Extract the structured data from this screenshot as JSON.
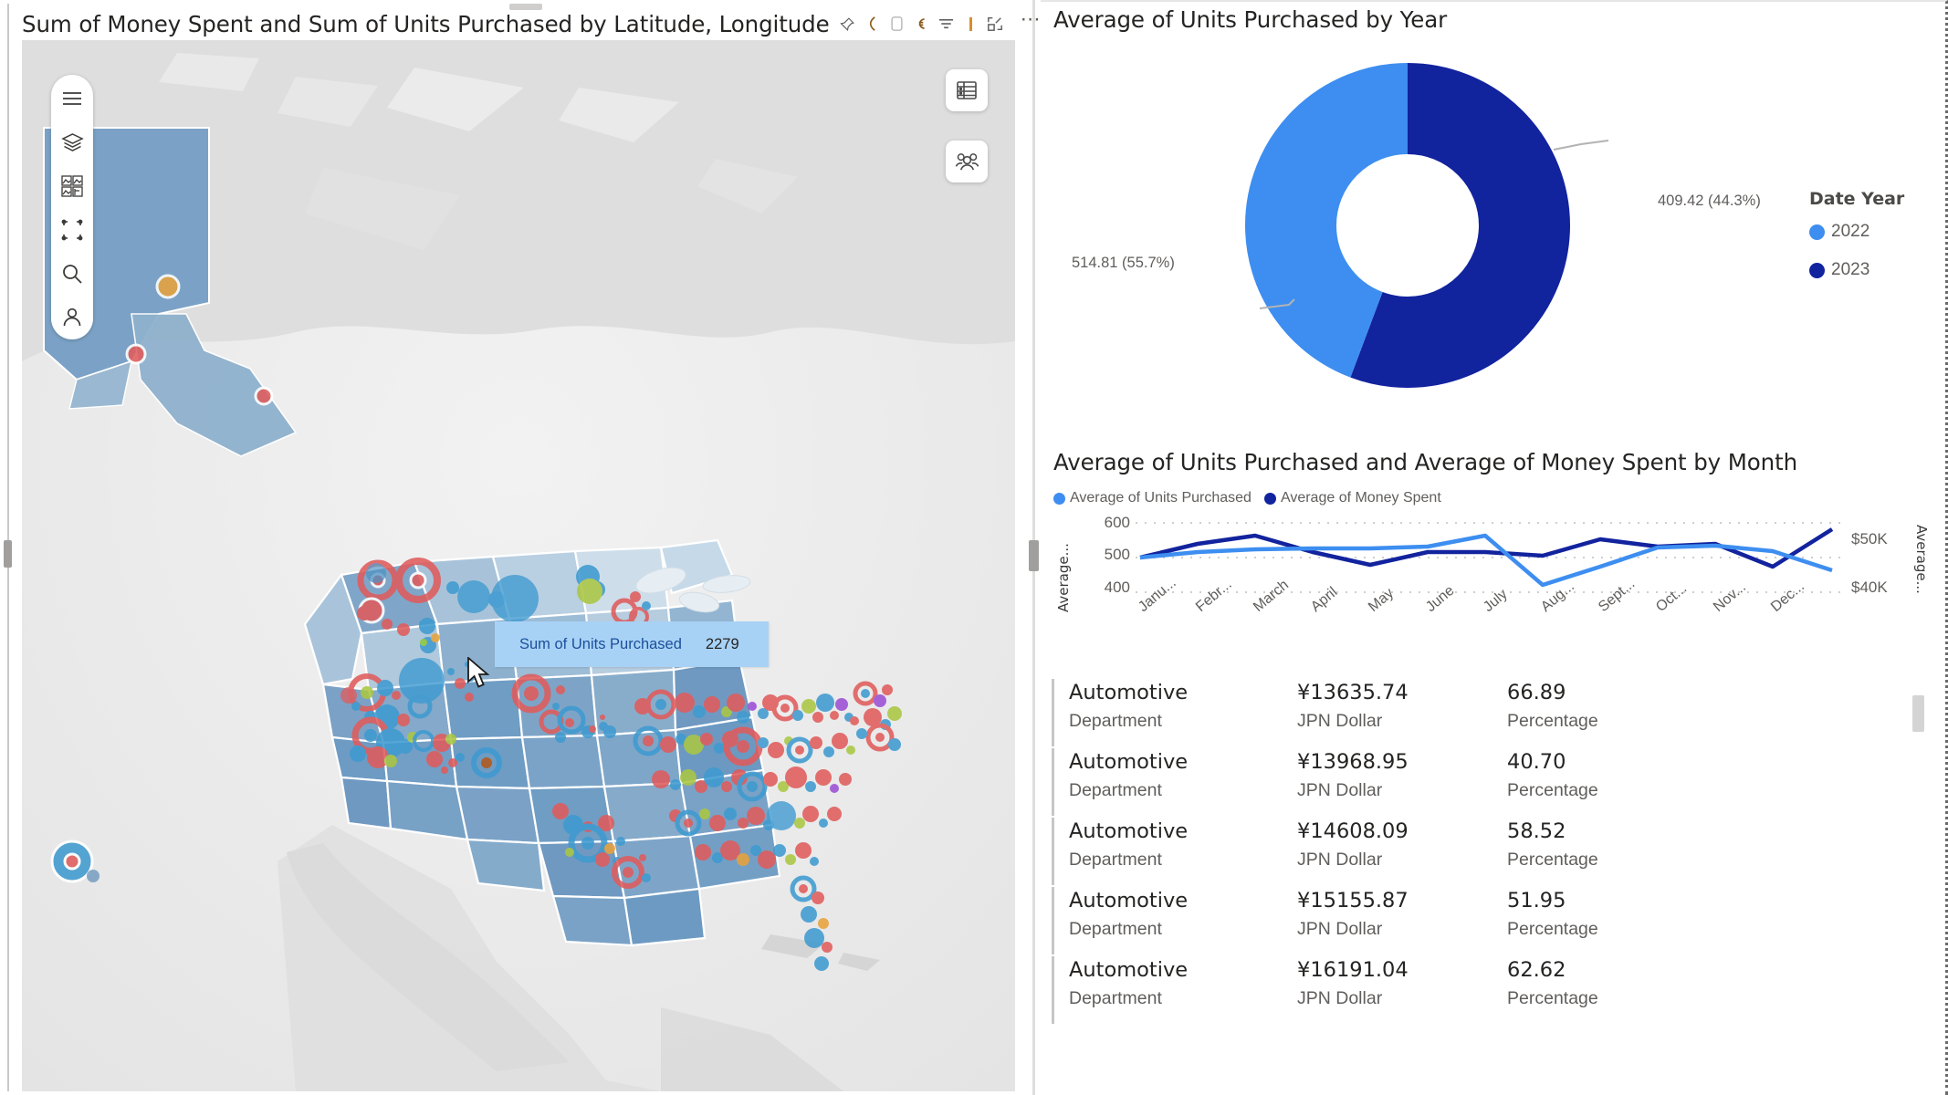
{
  "map_visual": {
    "title": "Sum of Money Spent and Sum of Units Purchased by Latitude, Longitude",
    "header_icons": [
      "pin-icon",
      "comment-icon",
      "bookmark-icon",
      "currency-icon",
      "filter-icon",
      "focus-mode-icon",
      "more-options-icon"
    ],
    "rail_buttons": [
      "hamburger-menu-icon",
      "layers-icon",
      "basemap-gallery-icon",
      "selection-box-icon",
      "search-icon",
      "locate-person-icon"
    ],
    "corner_buttons": [
      "table-legend-icon",
      "people-group-icon"
    ],
    "tooltip": {
      "label": "Sum of Units Purchased",
      "value": "2279"
    }
  },
  "donut_visual": {
    "title": "Average of Units Purchased by Year",
    "legend_title": "Date Year",
    "callout_left": "514.81 (55.7%)",
    "callout_right": "409.42 (44.3%)",
    "legend": [
      {
        "label": "2022",
        "color": "#3d8ef0"
      },
      {
        "label": "2023",
        "color": "#12239e"
      }
    ]
  },
  "line_visual": {
    "title": "Average of Units Purchased and Average of Money Spent by Month",
    "legend": [
      {
        "label": "Average of Units Purchased",
        "color": "#3d8ef0"
      },
      {
        "label": "Average of Money Spent",
        "color": "#12239e"
      }
    ],
    "y_left_title": "Average...",
    "y_right_title": "Average...",
    "y_left_ticks": [
      "600",
      "500",
      "400"
    ],
    "y_right_ticks": [
      "$50K",
      "$40K"
    ],
    "x_ticks": [
      "Janu...",
      "Febr...",
      "March",
      "April",
      "May",
      "June",
      "July",
      "Aug...",
      "Sept...",
      "Oct...",
      "Nov...",
      "Dec..."
    ]
  },
  "chart_data": [
    {
      "type": "pie",
      "title": "Average of Units Purchased by Year",
      "legend_title": "Date Year",
      "legend_position": "right",
      "labels": [
        "2022",
        "2023"
      ],
      "values": [
        409.42,
        514.81
      ],
      "percentages": [
        44.3,
        55.7
      ],
      "data_labels": [
        "409.42 (44.3%)",
        "514.81 (55.7%)"
      ],
      "colors": [
        "#3d8ef0",
        "#12239e"
      ]
    },
    {
      "type": "line",
      "title": "Average of Units Purchased and Average of Money Spent by Month",
      "xlabel": "",
      "ylabel": "Average...",
      "grid": true,
      "legend_position": "top",
      "categories": [
        "January",
        "February",
        "March",
        "April",
        "May",
        "June",
        "July",
        "August",
        "September",
        "October",
        "November",
        "December"
      ],
      "tick_labels": [
        "Janu...",
        "Febr...",
        "March",
        "April",
        "May",
        "June",
        "July",
        "Aug...",
        "Sept...",
        "Oct...",
        "Nov...",
        "Dec..."
      ],
      "axes": [
        {
          "side": "left",
          "ticks": [
            400,
            500,
            600
          ],
          "ylim": [
            350,
            650
          ],
          "title": "Average..."
        },
        {
          "side": "right",
          "ticks": [
            40000,
            50000
          ],
          "tick_labels": [
            "$40K",
            "$50K"
          ],
          "ylim": [
            35000,
            55000
          ],
          "title": "Average..."
        }
      ],
      "series": [
        {
          "name": "Average of Units Purchased",
          "color": "#3d8ef0",
          "axis": "left",
          "values": [
            502,
            520,
            527,
            528,
            529,
            533,
            553,
            438,
            490,
            530,
            536,
            521,
            478
          ]
        },
        {
          "name": "Average of Money Spent",
          "color": "#12239e",
          "axis": "right",
          "values": [
            46100,
            48700,
            50700,
            47000,
            44900,
            47000,
            47000,
            46500,
            49200,
            47900,
            48200,
            44700,
            51500
          ]
        }
      ]
    }
  ],
  "cards": {
    "rows": [
      {
        "name": "Automotive",
        "name_cat": "Department",
        "amount": "¥13635.74",
        "amount_cat": "JPN Dollar",
        "pct": "66.89",
        "pct_cat": "Percentage"
      },
      {
        "name": "Automotive",
        "name_cat": "Department",
        "amount": "¥13968.95",
        "amount_cat": "JPN Dollar",
        "pct": "40.70",
        "pct_cat": "Percentage"
      },
      {
        "name": "Automotive",
        "name_cat": "Department",
        "amount": "¥14608.09",
        "amount_cat": "JPN Dollar",
        "pct": "58.52",
        "pct_cat": "Percentage"
      },
      {
        "name": "Automotive",
        "name_cat": "Department",
        "amount": "¥15155.87",
        "amount_cat": "JPN Dollar",
        "pct": "51.95",
        "pct_cat": "Percentage"
      },
      {
        "name": "Automotive",
        "name_cat": "Department",
        "amount": "¥16191.04",
        "amount_cat": "JPN Dollar",
        "pct": "62.62",
        "pct_cat": "Percentage"
      }
    ]
  },
  "colors": {
    "accent_light": "#3d8ef0",
    "accent_dark": "#12239e",
    "tooltip_bg": "#a8d2f5",
    "tooltip_text": "#1b4f9c",
    "map_land": "#dcdcdc",
    "map_water": "#efefef",
    "state_fill": "#6f9dc4"
  }
}
